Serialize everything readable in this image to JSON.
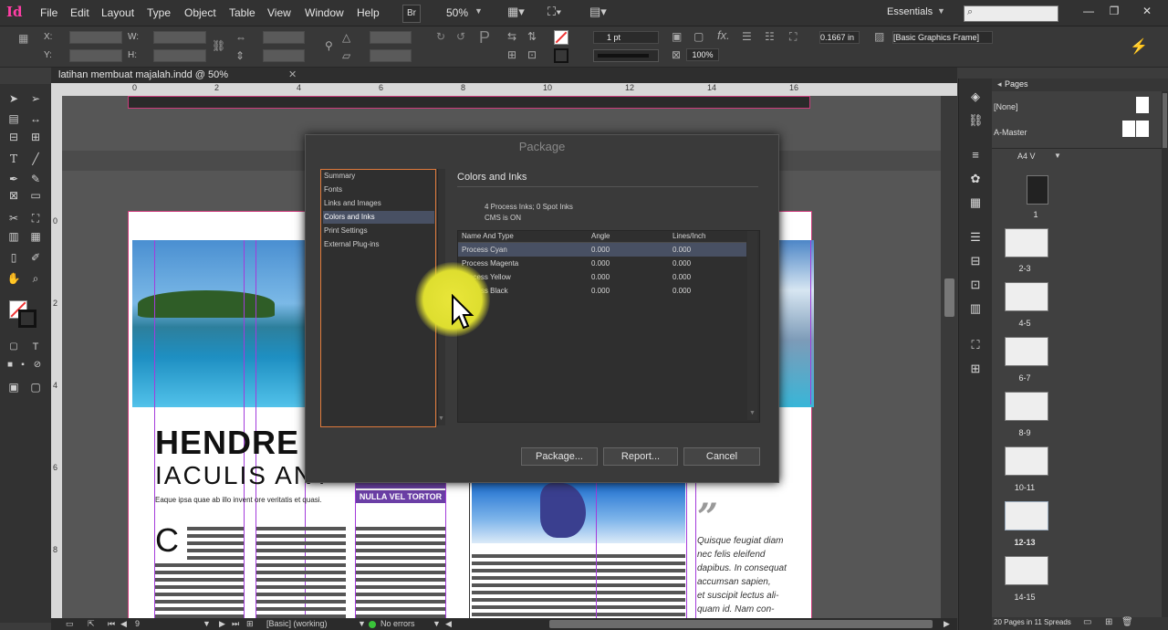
{
  "app": {
    "logo": "Id",
    "menu": [
      "File",
      "Edit",
      "Layout",
      "Type",
      "Object",
      "Table",
      "View",
      "Window",
      "Help"
    ],
    "bridge_label": "Br",
    "zoom": "50%",
    "workspace": "Essentials",
    "window_buttons": [
      "—",
      "❐",
      "✕"
    ]
  },
  "control_bar": {
    "x_label": "X:",
    "y_label": "Y:",
    "w_label": "W:",
    "h_label": "H:",
    "stroke_weight": "1 pt",
    "ref_value": "0.1667 in",
    "scale_percent": "100%",
    "object_style": "[Basic Graphics Frame]"
  },
  "document": {
    "tab_title": "latihan membuat majalah.indd @ 50%",
    "ruler_h": [
      "0",
      "2",
      "4",
      "6",
      "8",
      "10",
      "12",
      "14",
      "16"
    ],
    "ruler_v": [
      "0",
      "2",
      "4",
      "6",
      "8"
    ],
    "heading1": "HENDRE",
    "heading2": "IACULIS ANT",
    "lead": "Eaque ipsa quae ab illo invent ore veritatis et quasi.",
    "dropcap": "C",
    "box_label": "NULLA VEL TORTOR",
    "quote_mark": "”",
    "quote_text": [
      "Quisque feugiat diam",
      "nec felis eleifend",
      "dapibus. In consequat",
      "accumsan sapien,",
      "et suscipit lectus ali-",
      "quam id. Nam con-"
    ]
  },
  "status_bar": {
    "page": "9",
    "style": "[Basic] (working)",
    "preflight": "No errors"
  },
  "pages_panel": {
    "title": "Pages",
    "none_label": "[None]",
    "master_label": "A-Master",
    "size_label": "A4 V",
    "spreads": [
      "1",
      "2-3",
      "4-5",
      "6-7",
      "8-9",
      "10-11",
      "12-13",
      "14-15"
    ],
    "footer": "20 Pages in 11 Spreads"
  },
  "dialog": {
    "title": "Package",
    "categories": [
      "Summary",
      "Fonts",
      "Links and Images",
      "Colors and Inks",
      "Print Settings",
      "External Plug-ins"
    ],
    "selected_category": "Colors and Inks",
    "panel_heading": "Colors and Inks",
    "summary_line1": "4 Process Inks; 0 Spot Inks",
    "summary_line2": "CMS is ON",
    "columns": [
      "Name And Type",
      "Angle",
      "Lines/Inch"
    ],
    "inks": [
      {
        "name": "Process Cyan",
        "angle": "0.000",
        "lpi": "0.000"
      },
      {
        "name": "Process Magenta",
        "angle": "0.000",
        "lpi": "0.000"
      },
      {
        "name": "Process Yellow",
        "angle": "0.000",
        "lpi": "0.000"
      },
      {
        "name": "Process Black",
        "angle": "0.000",
        "lpi": "0.000"
      }
    ],
    "buttons": {
      "package": "Package...",
      "report": "Report...",
      "cancel": "Cancel"
    }
  },
  "colors": {
    "accent": "#ff3ea5",
    "selection": "#485063",
    "focus_border": "#e07a3c",
    "guide_purple": "#a33bdb",
    "cursor_highlight": "#e9e63a"
  }
}
